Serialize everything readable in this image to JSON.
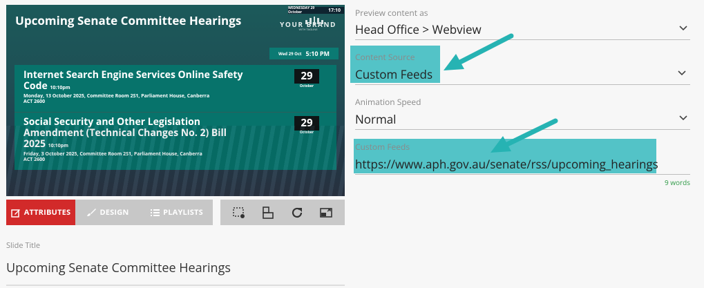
{
  "preview": {
    "title": "Upcoming Senate Committee Hearings",
    "topbar_date": "WEDNESDAY 29 October",
    "topbar_time": "17:10",
    "brand_name": "YOUR BRAND",
    "brand_tagline": "WITH TAGLINE",
    "current_date": "Wed 29 Oct",
    "current_time": "5:10 PM",
    "events": [
      {
        "title_line1": "Internet Search Engine Services Online Safety",
        "title_line2": "Code",
        "time": "10:10pm",
        "details_line1": "Monday, 13 October 2025, Committee Room 2S1, Parliament House, Canberra",
        "details_line2": "ACT 2600",
        "day": "29",
        "month": "October"
      },
      {
        "title_line1": "Social Security and Other Legislation",
        "title_line2": "Amendment (Technical Changes No. 2) Bill",
        "title_line3": "2025",
        "time": "10:10pm",
        "details_line1": "Friday, 3 October 2025, Committee Room 2S1, Parliament House, Canberra",
        "details_line2": "ACT 2600",
        "day": "29",
        "month": "October"
      }
    ]
  },
  "tabs": [
    {
      "label": "ATTRIBUTES",
      "icon": "edit-icon",
      "active": true
    },
    {
      "label": "DESIGN",
      "icon": "brush-icon"
    },
    {
      "label": "PLAYLISTS",
      "icon": "list-icon"
    }
  ],
  "toolbar": {
    "icons": [
      "crop-settings-icon",
      "layers-icon",
      "refresh-icon",
      "screen-resize-icon"
    ]
  },
  "slide_title": {
    "label": "Slide Title",
    "value": "Upcoming Senate Committee Hearings"
  },
  "fields": {
    "preview_content_as": {
      "label": "Preview content as",
      "value": "Head Office > Webview"
    },
    "content_source": {
      "label": "Content Source",
      "value": "Custom Feeds"
    },
    "animation_speed": {
      "label": "Animation Speed",
      "value": "Normal"
    },
    "custom_feeds": {
      "label": "Custom Feeds",
      "value": "https://www.aph.gov.au/senate/rss/upcoming_hearings",
      "word_count": "9 words"
    }
  },
  "colors": {
    "accent_red": "#d22a2a",
    "highlight_teal": "#53c3c7",
    "arrow_teal": "#26b3b3",
    "panel_teal": "#07736b"
  }
}
